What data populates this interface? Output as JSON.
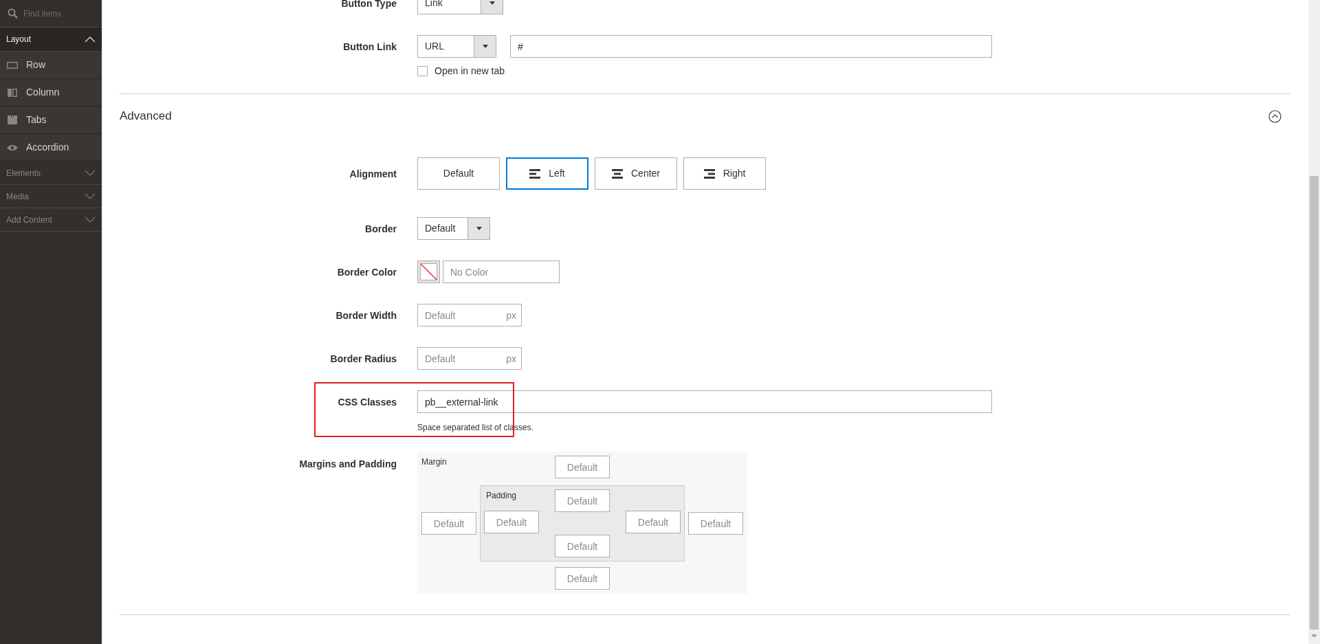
{
  "sidebar": {
    "search": {
      "placeholder": "Find items"
    },
    "sections": [
      {
        "label": "Layout",
        "expanded": true,
        "items": [
          {
            "label": "Row",
            "kind": "row"
          },
          {
            "label": "Column",
            "kind": "column"
          },
          {
            "label": "Tabs",
            "kind": "tabs"
          },
          {
            "label": "Accordion",
            "kind": "accordion"
          }
        ]
      },
      {
        "label": "Elements",
        "expanded": false
      },
      {
        "label": "Media",
        "expanded": false
      },
      {
        "label": "Add Content",
        "expanded": false
      }
    ]
  },
  "button_type": {
    "label": "Button Type",
    "value": "Link"
  },
  "button_link": {
    "label": "Button Link",
    "type_value": "URL",
    "value": "#",
    "new_tab": {
      "label": "Open in new tab",
      "checked": false
    }
  },
  "advanced": {
    "title": "Advanced",
    "expanded": true,
    "alignment": {
      "label": "Alignment",
      "options": [
        {
          "label": "Default",
          "kind": "none",
          "selected": false
        },
        {
          "label": "Left",
          "kind": "left",
          "selected": true
        },
        {
          "label": "Center",
          "kind": "center",
          "selected": false
        },
        {
          "label": "Right",
          "kind": "right",
          "selected": false
        }
      ]
    },
    "border": {
      "label": "Border",
      "value": "Default"
    },
    "border_color": {
      "label": "Border Color",
      "placeholder": "No Color"
    },
    "border_width": {
      "label": "Border Width",
      "placeholder": "Default",
      "unit": "px"
    },
    "border_radius": {
      "label": "Border Radius",
      "placeholder": "Default",
      "unit": "px"
    },
    "css_classes": {
      "label": "CSS Classes",
      "value": "pb__external-link",
      "hint": "Space separated list of classes.",
      "highlighted": true
    },
    "margins_padding": {
      "label": "Margins and Padding",
      "margin_label": "Margin",
      "padding_label": "Padding",
      "margin": {
        "top": {
          "placeholder": "Default"
        },
        "left": {
          "placeholder": "Default"
        },
        "right": {
          "placeholder": "Default"
        },
        "bottom": {
          "placeholder": "Default"
        }
      },
      "padding": {
        "top": {
          "placeholder": "Default"
        },
        "left": {
          "placeholder": "Default"
        },
        "right": {
          "placeholder": "Default"
        },
        "bottom": {
          "placeholder": "Default"
        }
      }
    }
  }
}
